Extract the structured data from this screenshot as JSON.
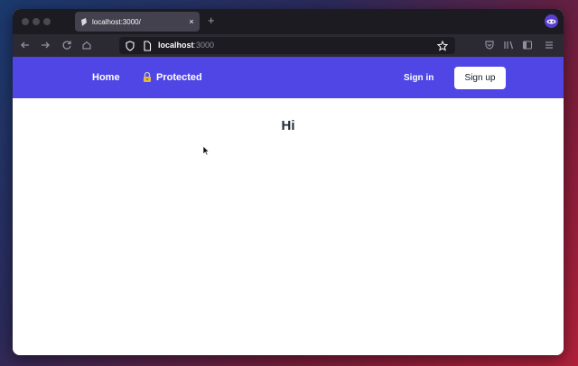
{
  "browser": {
    "tab_title": "localhost:3000/",
    "tab_close": "×",
    "new_tab": "+",
    "url_host": "localhost",
    "url_port": ":3000"
  },
  "app": {
    "nav": {
      "home": "Home",
      "protected": "Protected",
      "sign_in": "Sign in",
      "sign_up": "Sign up"
    },
    "heading": "Hi"
  },
  "colors": {
    "nav_bg": "#4f46e5",
    "browser_chrome": "#2b2a33",
    "tab_strip": "#1c1b22"
  },
  "icons": [
    "back-arrow-icon",
    "forward-arrow-icon",
    "reload-icon",
    "home-icon",
    "shield-icon",
    "page-icon",
    "star-icon",
    "pocket-icon",
    "library-icon",
    "sidebar-icon",
    "menu-icon",
    "lock-emoji-icon",
    "account-icon",
    "cursor-icon"
  ]
}
